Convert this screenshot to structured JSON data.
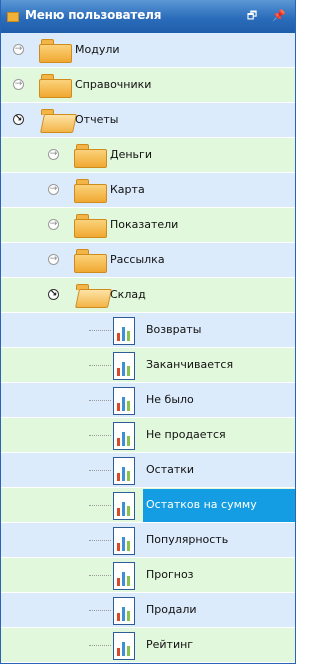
{
  "header": {
    "title": "Меню пользователя",
    "restore_icon": "restore-window-icon",
    "pin_icon": "pin-icon"
  },
  "tree": {
    "modules": "Модули",
    "reference": "Справочники",
    "reports": "Отчеты",
    "money": "Деньги",
    "map": "Карта",
    "indicators": "Показатели",
    "mailing": "Рассылка",
    "warehouse": "Склад",
    "warehouse_items": [
      "Возвраты",
      "Заканчивается",
      "Не было",
      "Не продается",
      "Остатки",
      "Остатков на сумму",
      "Популярность",
      "Прогноз",
      "Продали",
      "Рейтинг"
    ],
    "selected_item": "Остатков на сумму"
  },
  "colors": {
    "header_blue": "#2b6dbb",
    "row_blue": "#dcebfb",
    "row_green": "#e2f8dc",
    "selection": "#149de2",
    "folder_orange": "#f0a832"
  }
}
